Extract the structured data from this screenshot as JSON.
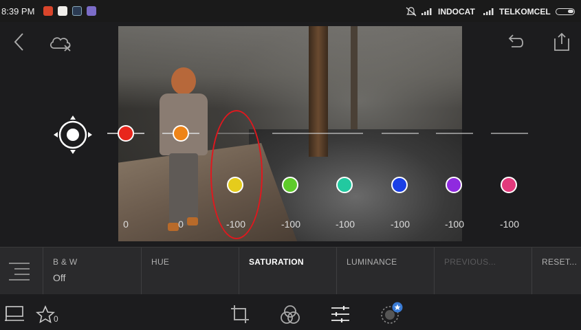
{
  "status_bar": {
    "time": "8:39 PM",
    "carriers": [
      "INDOCAT",
      "TELKOMCEL"
    ]
  },
  "hsl": {
    "saturation_values": [
      "0",
      "0",
      "-100",
      "-100",
      "-100",
      "-100",
      "-100",
      "-100"
    ],
    "colors": [
      "#e8261c",
      "#ee8418",
      "#e5cc1c",
      "#5ecb2a",
      "#22c9a0",
      "#1a3fe6",
      "#8f2adf",
      "#e23a7c"
    ],
    "channels": [
      "red",
      "orange",
      "yellow",
      "green",
      "aqua",
      "blue",
      "purple",
      "magenta"
    ]
  },
  "tabs": {
    "bw": {
      "label": "B & W",
      "value": "Off"
    },
    "hue": {
      "label": "HUE"
    },
    "saturation": {
      "label": "SATURATION"
    },
    "luminance": {
      "label": "LUMINANCE"
    },
    "previous": {
      "label": "PREVIOUS..."
    },
    "reset": {
      "label": "RESET..."
    }
  },
  "bottom_bar": {
    "rating_count": "0",
    "icons": [
      "flag-icon",
      "star-icon",
      "crop-icon",
      "presets-icon",
      "adjust-sliders-icon",
      "selective-edit-icon"
    ]
  }
}
